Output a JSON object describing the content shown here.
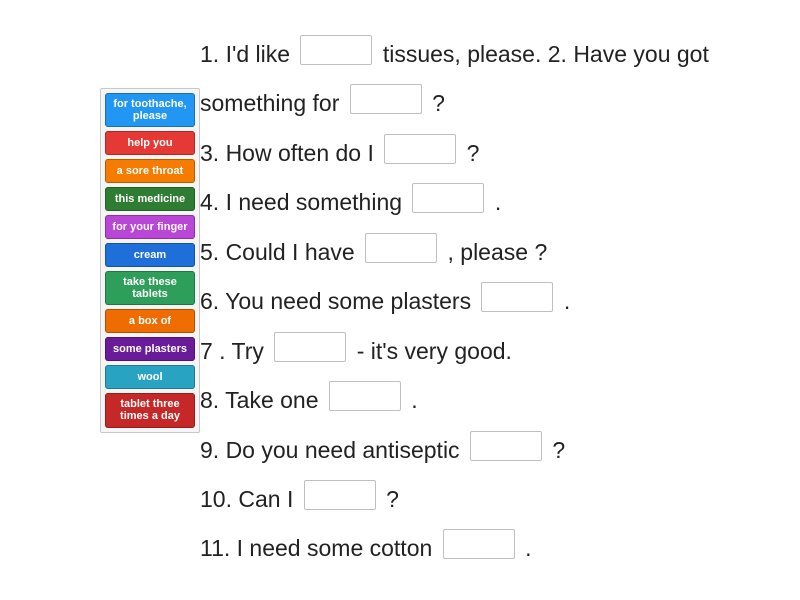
{
  "tiles": [
    {
      "label": "for toothache, please",
      "color": "#2196f3"
    },
    {
      "label": "help you",
      "color": "#e53935"
    },
    {
      "label": "a sore throat",
      "color": "#f57c00"
    },
    {
      "label": "this medicine",
      "color": "#2e7d32"
    },
    {
      "label": "for your finger",
      "color": "#b946d6"
    },
    {
      "label": "cream",
      "color": "#1e6fd9"
    },
    {
      "label": "take these tablets",
      "color": "#2e9e5b"
    },
    {
      "label": "a box of",
      "color": "#ef6c00"
    },
    {
      "label": "some plasters",
      "color": "#6a1b9a"
    },
    {
      "label": "wool",
      "color": "#29a3c2"
    },
    {
      "label": "tablet three times a day",
      "color": "#c62828"
    }
  ],
  "sentences": [
    {
      "pre": "1. I'd like ",
      "post": " tissues, please."
    },
    {
      "pre": "2. Have you got something for ",
      "post": "?"
    },
    {
      "pre": "3. How often do I ",
      "post": "?"
    },
    {
      "pre": "4. I need something ",
      "post": "."
    },
    {
      "pre": "5. Could I have ",
      "post": ", please ?"
    },
    {
      "pre": "6. You need some plasters ",
      "post": "."
    },
    {
      "pre": "7 . Try ",
      "post": " - it's very good."
    },
    {
      "pre": "8. Take one ",
      "post": "."
    },
    {
      "pre": "9. Do you need antiseptic ",
      "post": "?"
    },
    {
      "pre": "10. Can I ",
      "post": "?"
    },
    {
      "pre": "11. I need some cotton ",
      "post": "."
    }
  ]
}
